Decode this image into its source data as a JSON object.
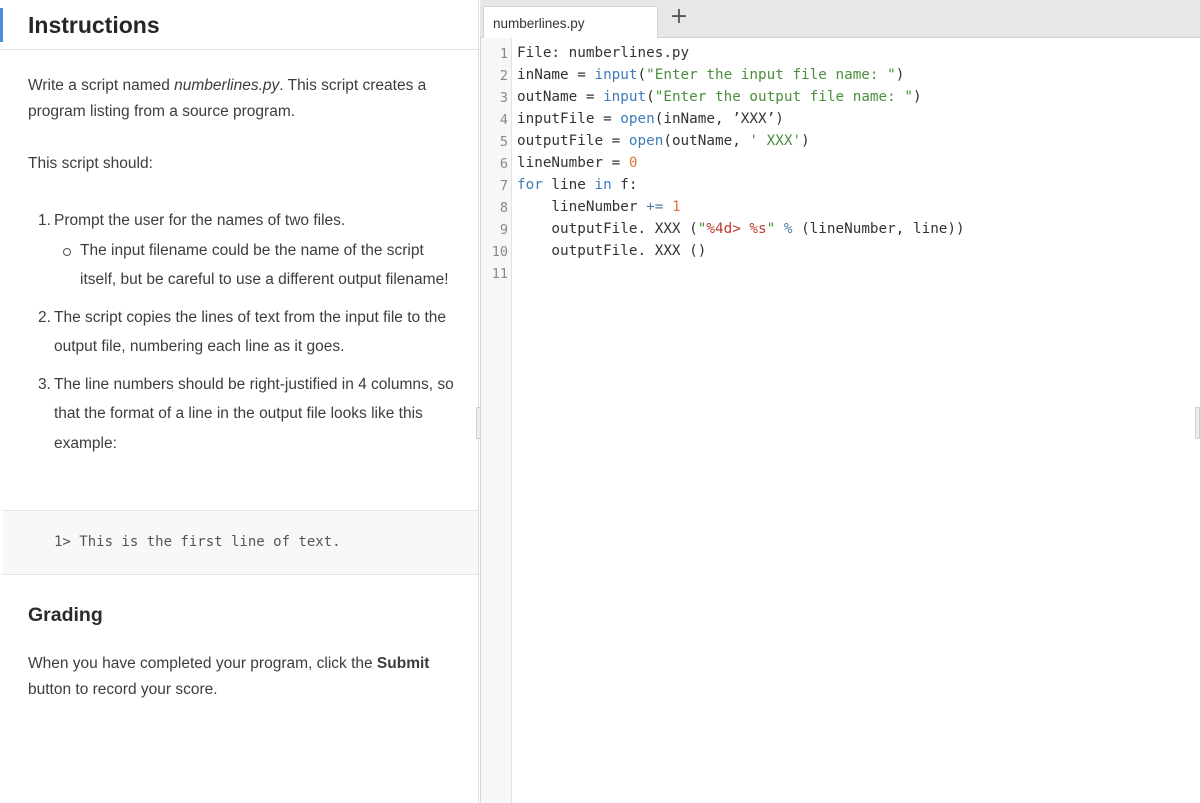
{
  "instructions": {
    "title": "Instructions",
    "intro_prefix": "Write a script named ",
    "intro_filename": "numberlines.py",
    "intro_suffix": ". This script creates a program listing from a source program.",
    "should": "This script should:",
    "steps": [
      {
        "num": "1.",
        "text": "Prompt the user for the names of two files.",
        "sub": "The input filename could be the name of the script itself, but be careful to use a different output filename!"
      },
      {
        "num": "2.",
        "text": "The script copies the lines of text from the input file to the output file, numbering each line as it goes."
      },
      {
        "num": "3.",
        "text": "The line numbers should be right-justified in 4 columns, so that the format of a line in the output file looks like this example:"
      }
    ],
    "example": "1> This is the first line of text.",
    "grading_title": "Grading",
    "grading_prefix": "When you have completed your program, click the ",
    "grading_bold": "Submit",
    "grading_suffix": " button to record your score."
  },
  "editor": {
    "tab_label": "numberlines.py",
    "add_tab_icon": "+",
    "line_numbers": [
      "1",
      "2",
      "3",
      "4",
      "5",
      "6",
      "7",
      "8",
      "9",
      "10",
      "11"
    ],
    "code": {
      "l1": "File: numberlines.py",
      "l2a": "inName = ",
      "l2b": "input",
      "l2c": "(",
      "l2d": "\"Enter the input file name: \"",
      "l2e": ")",
      "l3a": "outName = ",
      "l3b": "input",
      "l3c": "(",
      "l3d": "\"Enter the output file name: \"",
      "l3e": ")",
      "l4a": "inputFile = ",
      "l4b": "open",
      "l4c": "(inName, ",
      "l4d": "’XXX’",
      "l4e": ")",
      "l5a": "outputFile = ",
      "l5b": "open",
      "l5c": "(outName, ",
      "l5d": "' XXX'",
      "l5e": ")",
      "l6a": "lineNumber = ",
      "l6b": "0",
      "l7a": "for",
      "l7b": " line ",
      "l7c": "in",
      "l7d": " f:",
      "l8a": "    lineNumber ",
      "l8b": "+=",
      "l8c": " ",
      "l8d": "1",
      "l9a": "    outputFile. XXX (",
      "l9b": "\"",
      "l9c": "%4d>",
      "l9d": " ",
      "l9e": "%s",
      "l9f": "\"",
      "l9g": " ",
      "l9h": "%",
      "l9i": " (lineNumber, line))",
      "l10": "    outputFile. XXX ()"
    }
  },
  "colors": {
    "accent": "#4a90d9",
    "string": "#4a8f3c",
    "keyword": "#3e7bbd",
    "number": "#e0763a",
    "format": "#c0392b"
  }
}
